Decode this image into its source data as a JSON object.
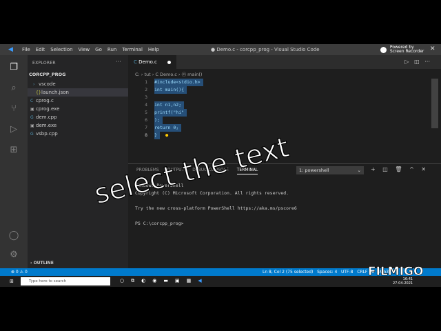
{
  "window": {
    "title": "● Demo.c - corcpp_prog - Visual Studio Code",
    "menu": [
      "File",
      "Edit",
      "Selection",
      "View",
      "Go",
      "Run",
      "Terminal",
      "Help"
    ],
    "recorder_line1": "Powered by",
    "recorder_line2": "Screen Recorder",
    "close": "✕"
  },
  "sidebar": {
    "title": "EXPLORER",
    "more": "···",
    "project": "CORCPP_PROG",
    "items": [
      {
        "label": "vscode",
        "icon": "›"
      },
      {
        "label": "launch.json",
        "icon": "{}"
      },
      {
        "label": "cprog.c",
        "icon": "C"
      },
      {
        "label": "cprog.exe",
        "icon": "▣"
      },
      {
        "label": "dem.cpp",
        "icon": "G"
      },
      {
        "label": "dem.exe",
        "icon": "▣"
      },
      {
        "label": "vsbp.cpp",
        "icon": "G"
      }
    ],
    "outline": "OUTLINE"
  },
  "editor": {
    "tab_label": "Demo.c",
    "breadcrumb": "C: › tut › C Demo.c › ⓜ main()",
    "lines": [
      {
        "n": "1",
        "text": "#include<stdio.h>"
      },
      {
        "n": "2",
        "text": "int main(){"
      },
      {
        "n": "3",
        "text": ""
      },
      {
        "n": "4",
        "text": "int n1,n2;"
      },
      {
        "n": "5",
        "text": "printf(\"hi\""
      },
      {
        "n": "6",
        "text": ");"
      },
      {
        "n": "7",
        "text": "return 0;"
      },
      {
        "n": "8",
        "text": "}"
      }
    ]
  },
  "panel": {
    "tabs": [
      "PROBLEMS",
      "OUTPUT",
      "DEBUG CONSOLE",
      "TERMINAL"
    ],
    "active_tab": "TERMINAL",
    "terminal_select": "1: powershell",
    "terminal_lines": [
      "Windows PowerShell",
      "Copyright (C) Microsoft Corporation. All rights reserved.",
      "",
      "Try the new cross-platform PowerShell https://aka.ms/pscore6",
      "",
      "PS C:\\corcpp_prog>"
    ]
  },
  "status": {
    "left": "⊗ 0  ⚠ 0",
    "right": "Ln 8, Col 2 (75 selected)   Spaces: 4   UTF-8   CRLF   C   Win32"
  },
  "taskbar": {
    "search_placeholder": "Type here to search",
    "time": "16:41",
    "date": "27-04-2021"
  },
  "overlay": {
    "caption": "select the text",
    "watermark": "FILMIGO"
  }
}
